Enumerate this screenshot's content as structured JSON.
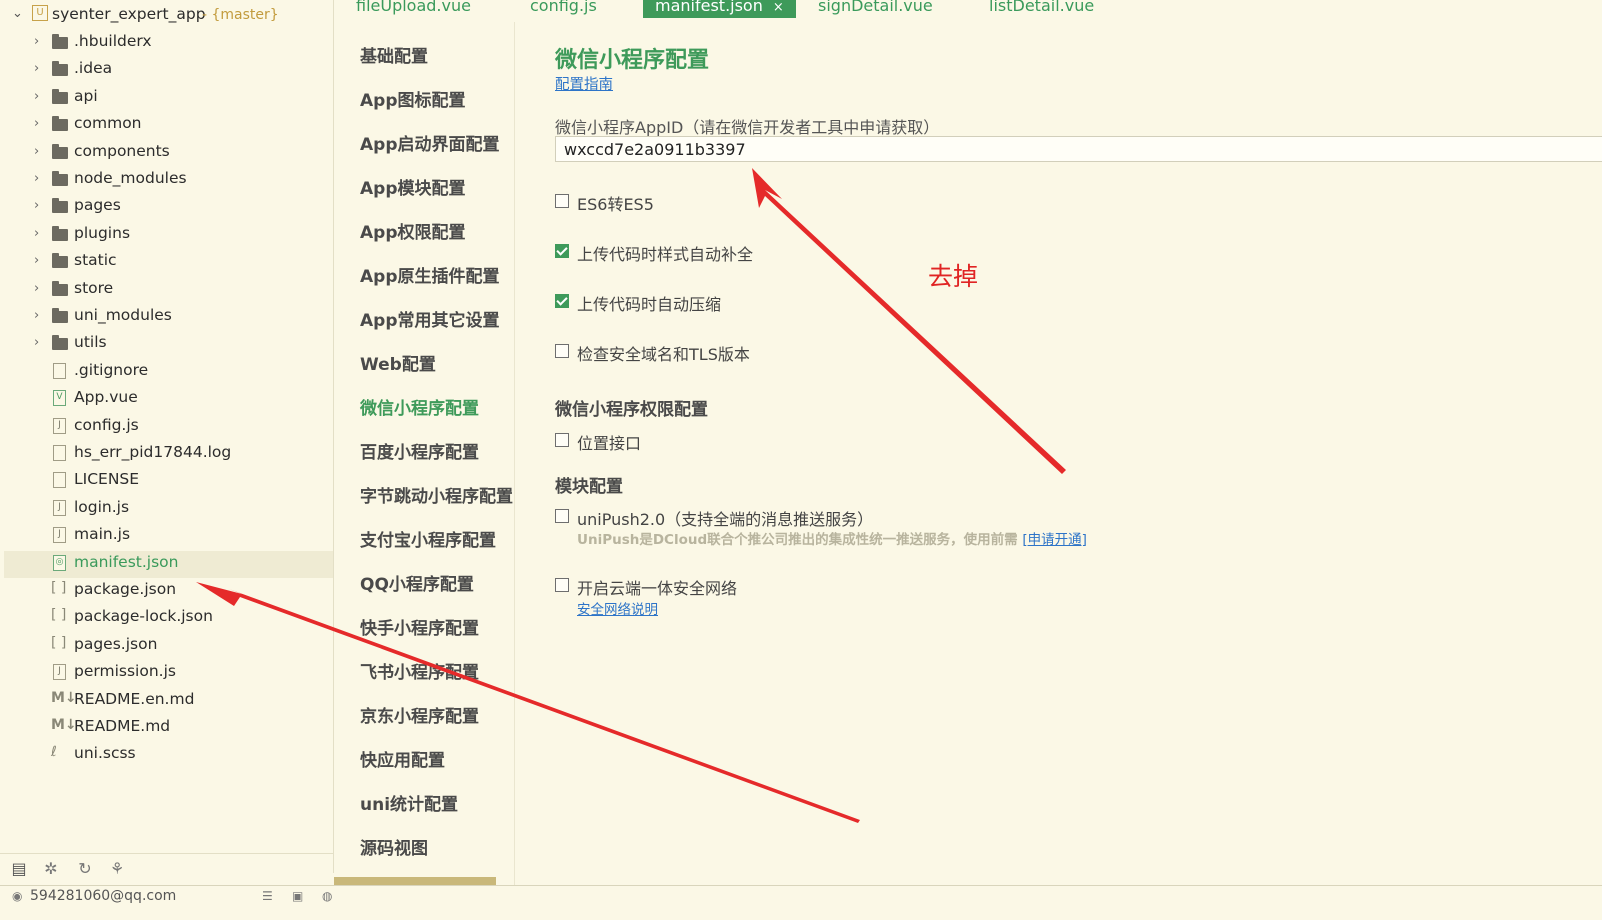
{
  "project": {
    "name": "syenter_expert_app",
    "branch": "- {master}"
  },
  "tree": {
    "items": [
      {
        "name": ".hbuilderx",
        "kind": "folder"
      },
      {
        "name": ".idea",
        "kind": "folder"
      },
      {
        "name": "api",
        "kind": "folder"
      },
      {
        "name": "common",
        "kind": "folder"
      },
      {
        "name": "components",
        "kind": "folder"
      },
      {
        "name": "node_modules",
        "kind": "folder"
      },
      {
        "name": "pages",
        "kind": "folder"
      },
      {
        "name": "plugins",
        "kind": "folder"
      },
      {
        "name": "static",
        "kind": "folder"
      },
      {
        "name": "store",
        "kind": "folder"
      },
      {
        "name": "uni_modules",
        "kind": "folder"
      },
      {
        "name": "utils",
        "kind": "folder"
      },
      {
        "name": ".gitignore",
        "kind": "file"
      },
      {
        "name": "App.vue",
        "kind": "vue"
      },
      {
        "name": "config.js",
        "kind": "js"
      },
      {
        "name": "hs_err_pid17844.log",
        "kind": "file"
      },
      {
        "name": "LICENSE",
        "kind": "file"
      },
      {
        "name": "login.js",
        "kind": "js"
      },
      {
        "name": "main.js",
        "kind": "js"
      },
      {
        "name": "manifest.json",
        "kind": "manifest",
        "selected": true
      },
      {
        "name": "package.json",
        "kind": "json"
      },
      {
        "name": "package-lock.json",
        "kind": "json"
      },
      {
        "name": "pages.json",
        "kind": "json"
      },
      {
        "name": "permission.js",
        "kind": "js"
      },
      {
        "name": "README.en.md",
        "kind": "md"
      },
      {
        "name": "README.md",
        "kind": "md"
      },
      {
        "name": "uni.scss",
        "kind": "scss"
      }
    ]
  },
  "tabs": [
    {
      "label": "fileUpload.vue",
      "active": false
    },
    {
      "label": "config.js",
      "active": false
    },
    {
      "label": "manifest.json",
      "active": true,
      "close": "×"
    },
    {
      "label": "signDetail.vue",
      "active": false
    },
    {
      "label": "listDetail.vue",
      "active": false
    }
  ],
  "nav": {
    "items": [
      {
        "label": "基础配置"
      },
      {
        "label": "App图标配置"
      },
      {
        "label": "App启动界面配置"
      },
      {
        "label": "App模块配置"
      },
      {
        "label": "App权限配置"
      },
      {
        "label": "App原生插件配置"
      },
      {
        "label": "App常用其它设置"
      },
      {
        "label": "Web配置"
      },
      {
        "label": "微信小程序配置",
        "active": true
      },
      {
        "label": "百度小程序配置"
      },
      {
        "label": "字节跳动小程序配置"
      },
      {
        "label": "支付宝小程序配置"
      },
      {
        "label": "QQ小程序配置"
      },
      {
        "label": "快手小程序配置"
      },
      {
        "label": "飞书小程序配置"
      },
      {
        "label": "京东小程序配置"
      },
      {
        "label": "快应用配置"
      },
      {
        "label": "uni统计配置"
      },
      {
        "label": "源码视图"
      }
    ]
  },
  "main": {
    "title": "微信小程序配置",
    "guide_link": "配置指南",
    "appid_label": "微信小程序AppID（请在微信开发者工具中申请获取）",
    "appid_value": "wxccd7e2a0911b3397",
    "options": [
      {
        "label": "ES6转ES5",
        "checked": false
      },
      {
        "label": "上传代码时样式自动补全",
        "checked": true
      },
      {
        "label": "上传代码时自动压缩",
        "checked": true
      },
      {
        "label": "检查安全域名和TLS版本",
        "checked": false
      }
    ],
    "permission_heading": "微信小程序权限配置",
    "location_label": "位置接口",
    "location_checked": false,
    "module_heading": "模块配置",
    "unipush_label": "uniPush2.0（支持全端的消息推送服务）",
    "unipush_checked": false,
    "unipush_desc": "UniPush是DCloud联合个推公司推出的集成性统一推送服务，使用前需",
    "unipush_apply_link": "[申请开通]",
    "security_label": "开启云端一体安全网络",
    "security_checked": false,
    "security_link": "安全网络说明"
  },
  "annotation": {
    "text": "去掉",
    "color": "#e02424"
  },
  "status": {
    "user": "594281060@qq.com"
  },
  "colors": {
    "accent": "#3e9a5a",
    "link": "#2d74c8",
    "background": "#fbf8e6"
  }
}
